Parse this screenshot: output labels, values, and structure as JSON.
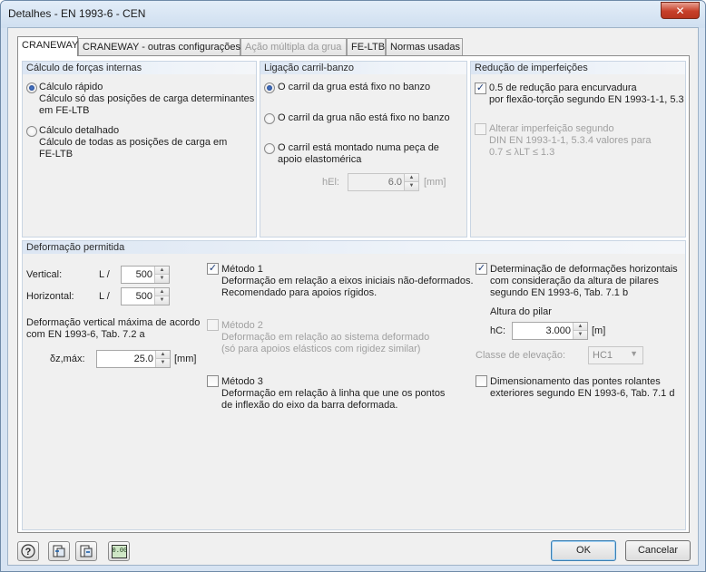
{
  "window": {
    "title": "Detalhes - EN 1993-6 - CEN",
    "close_label": "✕"
  },
  "tabs": [
    {
      "label": "CRANEWAY"
    },
    {
      "label": "CRANEWAY - outras configurações"
    },
    {
      "label": "Ação múltipla da grua"
    },
    {
      "label": "FE-LTB"
    },
    {
      "label": "Normas usadas"
    }
  ],
  "forcas": {
    "title": "Cálculo de forças internas",
    "opt1": {
      "label": "Cálculo rápido",
      "desc1": "Cálculo só das posições de carga determinantes",
      "desc2": "em FE-LTB",
      "selected": true
    },
    "opt2": {
      "label": "Cálculo detalhado",
      "desc1": "Cálculo de todas as posições de carga em",
      "desc2": "FE-LTB",
      "selected": false
    }
  },
  "ligacao": {
    "title": "Ligação carril-banzo",
    "opt1": "O carril da grua está fixo no banzo",
    "opt2": "O carril da grua não está fixo no banzo",
    "opt3a": "O carril está montado numa peça de",
    "opt3b": "apoio elastomérica",
    "hel_label": "hEl:",
    "hel_value": "6.0",
    "hel_unit": "[mm]"
  },
  "reducao": {
    "title": "Redução de imperfeições",
    "chk1a": "0.5 de redução para encurvadura",
    "chk1b": "por flexão-torção segundo EN 1993-1-1, 5.3",
    "chk2a": "Alterar imperfeição segundo",
    "chk2b": "DIN EN 1993-1-1, 5.3.4 valores para",
    "chk2c": "0.7 ≤ λLT ≤ 1.3"
  },
  "deformacao": {
    "title": "Deformação permitida",
    "vertical_label": "Vertical:",
    "horizontal_label": "Horizontal:",
    "l_label": "L /",
    "vertical_value": "500",
    "horizontal_value": "500",
    "max_a": "Deformação vertical máxima de acordo",
    "max_b": "com EN 1993-6, Tab. 7.2 a",
    "delta_label": "δz,máx:",
    "delta_value": "25.0",
    "delta_unit": "[mm]",
    "m1_label": "Método 1",
    "m1_desc1": "Deformação em relação a eixos iniciais não-deformados.",
    "m1_desc2": "Recomendado para apoios rígidos.",
    "m2_label": "Método 2",
    "m2_desc1": "Deformação em relação ao sistema deformado",
    "m2_desc2": "(só para apoios elásticos com rigidez similar)",
    "m3_label": "Método 3",
    "m3_desc1": "Deformação em relação à linha que une os pontos",
    "m3_desc2": "de inflexão do eixo da barra deformada.",
    "h_a": "Determinação de deformações horizontais",
    "h_b": "com consideração da altura de pilares",
    "h_c": "segundo EN 1993-6, Tab. 7.1 b",
    "altura_label": "Altura do pilar",
    "hc_label": "hC:",
    "hc_value": "3.000",
    "hc_unit": "[m]",
    "classe_label": "Classe de elevação:",
    "classe_value": "HC1",
    "dim_a": "Dimensionamento das pontes rolantes",
    "dim_b": "exteriores segundo EN 1993-6, Tab. 7.1 d"
  },
  "buttons": {
    "ok": "OK",
    "cancel": "Cancelar",
    "units_text": "0.00"
  }
}
